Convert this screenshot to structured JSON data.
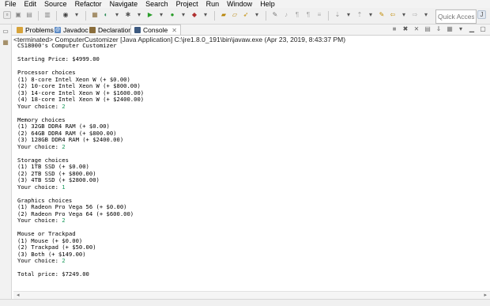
{
  "menu": [
    "File",
    "Edit",
    "Source",
    "Refactor",
    "Navigate",
    "Search",
    "Project",
    "Run",
    "Window",
    "Help"
  ],
  "toolbar": {
    "quick_access_placeholder": "Quick Access"
  },
  "tabs": [
    {
      "label": "Problems",
      "icon": "problems-icon"
    },
    {
      "label": "Javadoc",
      "icon": "javadoc-icon"
    },
    {
      "label": "Declaration",
      "icon": "declaration-icon"
    },
    {
      "label": "Console",
      "icon": "console-icon",
      "active": true
    }
  ],
  "console": {
    "header": "<terminated> ComputerCustomizer [Java Application] C:\\jre1.8.0_191\\bin\\javaw.exe (Apr 23, 2019, 8:43:37 PM)",
    "lines": [
      {
        "text": "CS18000's Computer Customizer"
      },
      {
        "text": ""
      },
      {
        "text": "Starting Price: $4999.00"
      },
      {
        "text": ""
      },
      {
        "text": "Processor choices"
      },
      {
        "text": "(1) 8-core Intel Xeon W (+ $0.00)"
      },
      {
        "text": "(2) 10-core Intel Xeon W (+ $800.00)"
      },
      {
        "text": "(3) 14-core Intel Xeon W (+ $1600.00)"
      },
      {
        "text": "(4) 18-core Intel Xeon W (+ $2400.00)"
      },
      {
        "text": "Your choice: ",
        "input": "2"
      },
      {
        "text": ""
      },
      {
        "text": "Memory choices"
      },
      {
        "text": "(1) 32GB DDR4 RAM (+ $0.00)"
      },
      {
        "text": "(2) 64GB DDR4 RAM (+ $800.00)"
      },
      {
        "text": "(3) 128GB DDR4 RAM (+ $2400.00)"
      },
      {
        "text": "Your choice: ",
        "input": "2"
      },
      {
        "text": ""
      },
      {
        "text": "Storage choices"
      },
      {
        "text": "(1) 1TB SSD (+ $0.00)"
      },
      {
        "text": "(2) 2TB SSD (+ $800.00)"
      },
      {
        "text": "(3) 4TB SSD (+ $2800.00)"
      },
      {
        "text": "Your choice: ",
        "input": "1"
      },
      {
        "text": ""
      },
      {
        "text": "Graphics choices"
      },
      {
        "text": "(1) Radeon Pro Vega 56 (+ $0.00)"
      },
      {
        "text": "(2) Radeon Pro Vega 64 (+ $600.00)"
      },
      {
        "text": "Your choice: ",
        "input": "2"
      },
      {
        "text": ""
      },
      {
        "text": "Mouse or Trackpad"
      },
      {
        "text": "(1) Mouse (+ $0.00)"
      },
      {
        "text": "(2) Trackpad (+ $50.00)"
      },
      {
        "text": "(3) Both (+ $149.00)"
      },
      {
        "text": "Your choice: ",
        "input": "2"
      },
      {
        "text": ""
      },
      {
        "text": "Total price: $7249.00"
      }
    ]
  },
  "colors": {
    "console_input": "#1a9a5b",
    "chrome_bg": "#f0f0f0"
  }
}
